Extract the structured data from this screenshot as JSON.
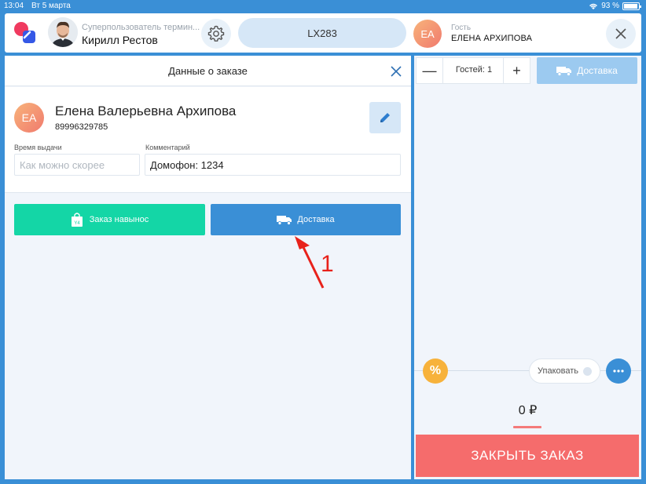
{
  "status_bar": {
    "time": "13:04",
    "date": "Вт 5 марта",
    "battery": "93 %",
    "battery_level": 0.93
  },
  "header": {
    "user_role": "Суперпользователь термин...",
    "user_name": "Кирилл Рестов",
    "table": "LX283",
    "guest_initials": "ЕА",
    "guest_role": "Гость",
    "guest_name": "ЕЛЕНА АРХИПОВА"
  },
  "order_panel": {
    "title": "Данные о заказе",
    "customer": {
      "initials": "ЕА",
      "name": "Елена Валерьевна Архипова",
      "phone": "89996329785"
    },
    "pickup_time": {
      "label": "Время выдачи",
      "placeholder": "Как можно скорее",
      "value": ""
    },
    "comment": {
      "label": "Комментарий",
      "value": "Домофон: 1234"
    },
    "takeaway_label": "Заказ навынос",
    "delivery_label": "Доставка",
    "annotation_number": "1"
  },
  "side_panel": {
    "guests_label": "Гостей: 1",
    "minus": "—",
    "plus": "+",
    "delivery_label": "Доставка",
    "discount_symbol": "%",
    "pack_label": "Упаковать",
    "total": "0 ₽",
    "close_order_label": "ЗАКРЫТЬ ЗАКАЗ"
  },
  "colors": {
    "accent": "#3a8fd6",
    "takeaway": "#14d6a6",
    "close_order": "#f56c6c",
    "discount": "#f7b23b"
  }
}
